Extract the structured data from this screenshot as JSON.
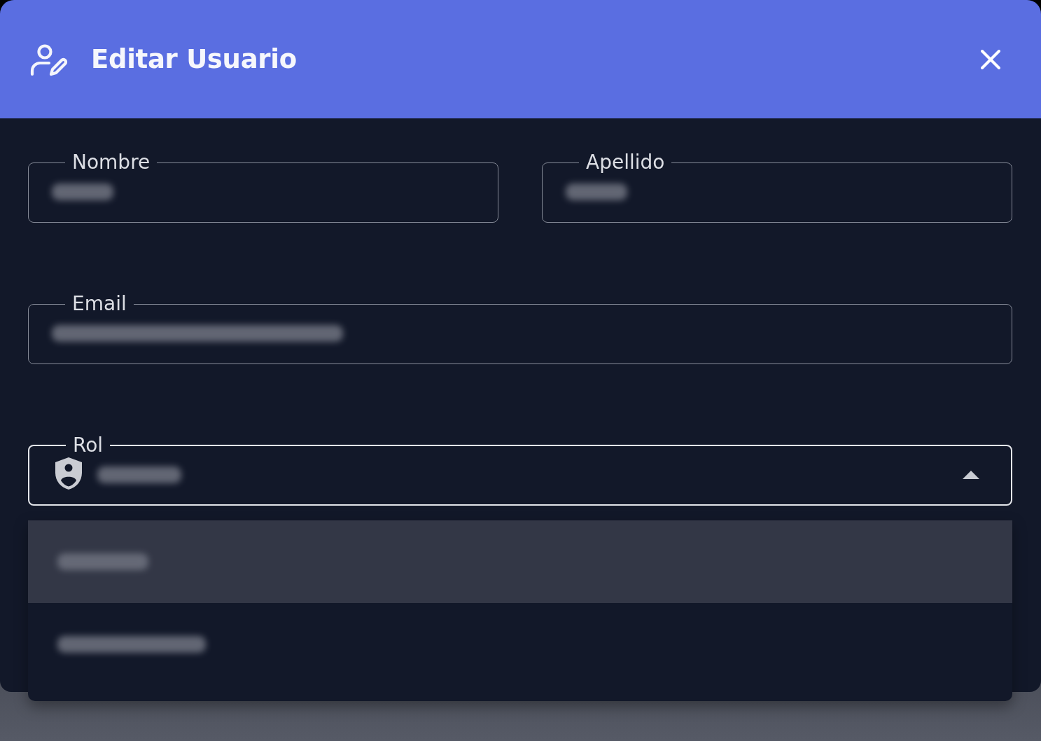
{
  "dialog": {
    "title": "Editar Usuario"
  },
  "form": {
    "rows": [
      {
        "fields": [
          {
            "label": "Nombre",
            "kind": "text",
            "value_blurred": true
          },
          {
            "label": "Apellido",
            "kind": "text",
            "value_blurred": true
          }
        ]
      },
      {
        "fields": [
          {
            "label": "Email",
            "kind": "text",
            "value_blurred": true
          }
        ]
      },
      {
        "fields": [
          {
            "label": "Rol",
            "kind": "select",
            "value_blurred": true,
            "expanded": true,
            "options": [
              {
                "blurred": true,
                "selected": true
              },
              {
                "blurred": true,
                "selected": false
              }
            ]
          }
        ]
      }
    ]
  }
}
